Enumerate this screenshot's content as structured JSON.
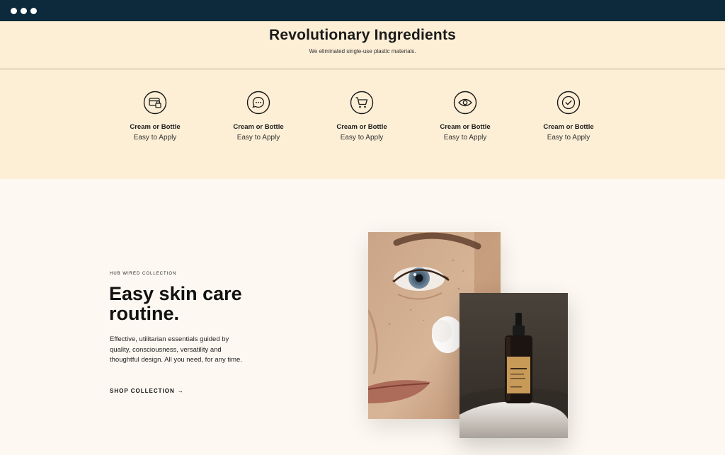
{
  "browser": {
    "controls": [
      "dot",
      "dot",
      "dot"
    ]
  },
  "ingredients": {
    "title": "Revolutionary Ingredients",
    "subtitle": "We eliminated single-use plastic materials.",
    "features": [
      {
        "icon": "card-icon",
        "title": "Cream or Bottle",
        "desc": "Easy to Apply"
      },
      {
        "icon": "chat-icon",
        "title": "Cream or Bottle",
        "desc": "Easy to Apply"
      },
      {
        "icon": "cart-icon",
        "title": "Cream or Bottle",
        "desc": "Easy to Apply"
      },
      {
        "icon": "eye-icon",
        "title": "Cream or Bottle",
        "desc": "Easy to Apply"
      },
      {
        "icon": "check-circle-icon",
        "title": "Cream or Bottle",
        "desc": "Easy to Apply"
      }
    ]
  },
  "hero": {
    "eyebrow": "HUB WIRED COLLECTION",
    "title": "Easy skin care routine.",
    "body": "Effective, utilitarian essentials guided by quality, consciousness, versatility and thoughtful design. All you need, for any time.",
    "cta": "SHOP COLLECTION",
    "cta_arrow": "→"
  },
  "colors": {
    "browser_bar": "#0c2a3b",
    "ingredients_bg": "#fdefd6",
    "hero_bg": "#fdf8f1"
  }
}
